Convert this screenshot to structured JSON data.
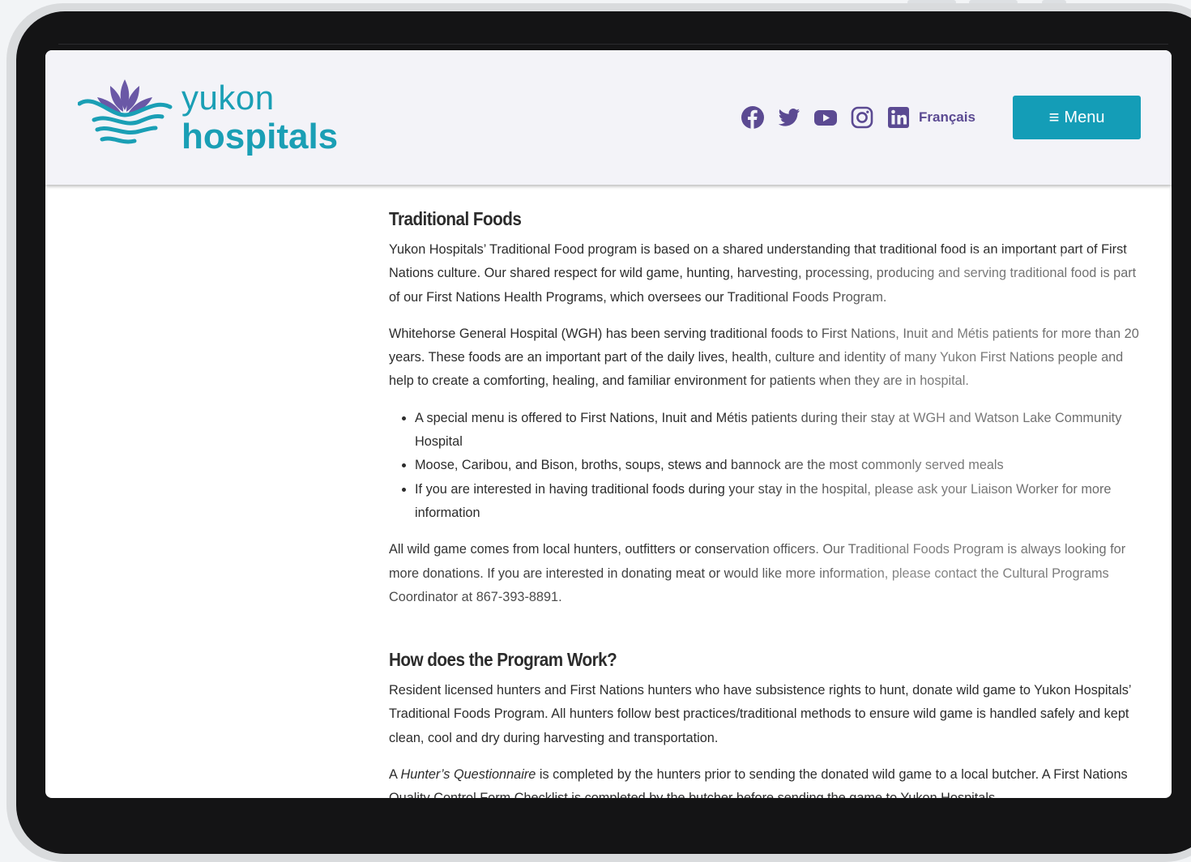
{
  "logo": {
    "line1": "yukon",
    "line2": "hospitals"
  },
  "header": {
    "social_icons": [
      "facebook-icon",
      "twitter-icon",
      "youtube-icon",
      "instagram-icon",
      "linkedin-icon"
    ],
    "language_link": "Français",
    "menu_icon": "≡",
    "menu_label": "Menu"
  },
  "colors": {
    "brand_teal": "#1a9fb5",
    "brand_purple": "#5b4a92",
    "menu_button": "#149db7",
    "header_bg": "#f3f3f8"
  },
  "section1": {
    "heading": "Traditional Foods",
    "para1": "Yukon Hospitals’ Traditional Food program is based on a shared understanding that traditional food is an important part of First Nations culture. Our shared respect for wild game, hunting, harvesting, processing, producing and serving traditional food is part of our First Nations Health Programs, which oversees our Traditional Foods Program.",
    "para2": "Whitehorse General Hospital (WGH) has been serving traditional foods to First Nations, Inuit and Métis patients for more than 20 years. These foods are an important part of the daily lives, health, culture and identity of many Yukon First Nations people and help to create a comforting, healing, and familiar environment for patients when they are in hospital.",
    "bullets": [
      "A special menu is offered to First Nations, Inuit and Métis patients during their stay at WGH and Watson Lake Community Hospital",
      "Moose, Caribou, and Bison, broths, soups, stews and bannock are the most commonly served meals",
      "If you are interested in having traditional foods during your stay in the hospital, please ask your Liaison Worker for more information"
    ],
    "para3": "All wild game comes from local hunters, outfitters or conservation officers. Our Traditional Foods Program is always looking for more donations. If you are interested in donating meat or would like more information, please contact the Cultural Programs Coordinator at 867-393-8891."
  },
  "section2": {
    "heading": "How does the Program Work?",
    "para1": "Resident licensed hunters and First Nations hunters who have subsistence rights to hunt, donate wild game to Yukon Hospitals’ Traditional Foods Program. All hunters follow best practices/traditional methods to ensure wild game is handled safely and kept clean, cool and dry during harvesting and transportation.",
    "para2_prefix": "A ",
    "para2_italic": "Hunter’s Questionnaire",
    "para2_rest": " is completed by the hunters prior to sending the donated wild game to a local butcher. A First Nations Quality Control Form Checklist is completed by the butcher before sending the game to Yukon Hospitals."
  }
}
